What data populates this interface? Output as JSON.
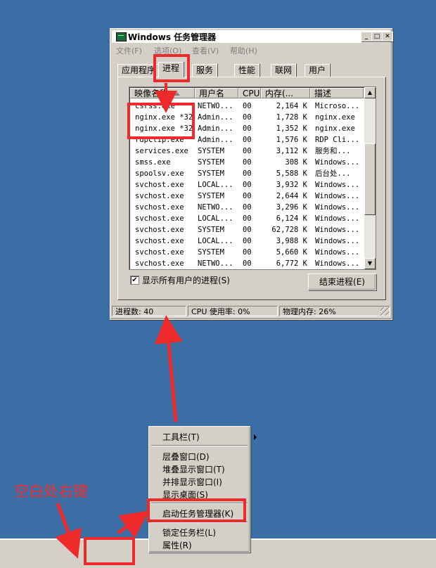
{
  "window": {
    "title": "Windows 任务管理器",
    "controls": [
      "_",
      "□",
      "✕"
    ],
    "menu": [
      "文件(F)",
      "选项(O)",
      "查看(V)",
      "帮助(H)"
    ],
    "tabs": [
      "应用程序",
      "进程",
      "服务",
      "性能",
      "联网",
      "用户"
    ],
    "active_tab": "进程"
  },
  "process_list": {
    "columns": [
      "映像名称",
      "用户名",
      "CPU",
      "内存(...",
      "描述"
    ],
    "rows": [
      {
        "name": "csrss.exe",
        "user": "NETWO...",
        "cpu": "00",
        "mem": "2,164 K",
        "desc": "Microso..."
      },
      {
        "name": "nginx.exe *32",
        "user": "Admin...",
        "cpu": "00",
        "mem": "1,728 K",
        "desc": "nginx.exe"
      },
      {
        "name": "nginx.exe *32",
        "user": "Admin...",
        "cpu": "00",
        "mem": "1,352 K",
        "desc": "nginx.exe"
      },
      {
        "name": "rdpclip.exe",
        "user": "Admin...",
        "cpu": "00",
        "mem": "1,576 K",
        "desc": "RDP Cli..."
      },
      {
        "name": "services.exe",
        "user": "SYSTEM",
        "cpu": "00",
        "mem": "3,112 K",
        "desc": "服务和..."
      },
      {
        "name": "smss.exe",
        "user": "SYSTEM",
        "cpu": "00",
        "mem": "308 K",
        "desc": "Windows..."
      },
      {
        "name": "spoolsv.exe",
        "user": "SYSTEM",
        "cpu": "00",
        "mem": "5,588 K",
        "desc": "后台处..."
      },
      {
        "name": "svchost.exe",
        "user": "LOCAL...",
        "cpu": "00",
        "mem": "3,932 K",
        "desc": "Windows..."
      },
      {
        "name": "svchost.exe",
        "user": "SYSTEM",
        "cpu": "00",
        "mem": "2,644 K",
        "desc": "Windows..."
      },
      {
        "name": "svchost.exe",
        "user": "NETWO...",
        "cpu": "00",
        "mem": "3,296 K",
        "desc": "Windows..."
      },
      {
        "name": "svchost.exe",
        "user": "LOCAL...",
        "cpu": "00",
        "mem": "6,124 K",
        "desc": "Windows..."
      },
      {
        "name": "svchost.exe",
        "user": "SYSTEM",
        "cpu": "00",
        "mem": "62,728 K",
        "desc": "Windows..."
      },
      {
        "name": "svchost.exe",
        "user": "LOCAL...",
        "cpu": "00",
        "mem": "3,988 K",
        "desc": "Windows..."
      },
      {
        "name": "svchost.exe",
        "user": "SYSTEM",
        "cpu": "00",
        "mem": "5,660 K",
        "desc": "Windows..."
      },
      {
        "name": "svchost.exe",
        "user": "NETWO...",
        "cpu": "00",
        "mem": "6,772 K",
        "desc": "Windows..."
      }
    ]
  },
  "show_all_users": {
    "label": "显示所有用户的进程(S)",
    "checked": "✔"
  },
  "end_process_button": "结束进程(E)",
  "status": {
    "processes": "进程数: 40",
    "cpu": "CPU 使用率: 0%",
    "memory": "物理内存: 26%"
  },
  "context_menu": {
    "items": [
      "工具栏(T)",
      "层叠窗口(D)",
      "堆叠显示窗口(T)",
      "并排显示窗口(I)",
      "显示桌面(S)",
      "启动任务管理器(K)",
      "锁定任务栏(L)",
      "属性(R)"
    ]
  },
  "annotation": {
    "text": "空白处右键",
    "color": "#ee2a2a"
  },
  "colors": {
    "desktop": "#3a6ea5",
    "face": "#d4d0c8"
  },
  "icons": [
    "task-manager-icon",
    "minimize-icon",
    "maximize-icon",
    "close-icon",
    "sort-up-icon",
    "scroll-up-icon",
    "scroll-down-icon",
    "submenu-arrow-icon",
    "size-grip-icon"
  ]
}
